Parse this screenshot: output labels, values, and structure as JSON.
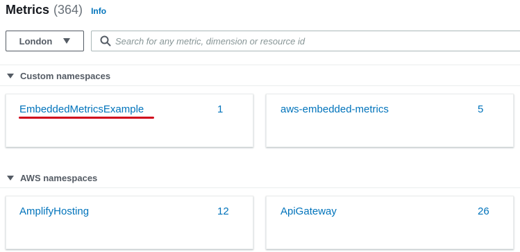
{
  "header": {
    "title": "Metrics",
    "count": "(364)",
    "info_label": "Info"
  },
  "toolbar": {
    "region_label": "London",
    "search_placeholder": "Search for any metric, dimension or resource id"
  },
  "sections": {
    "custom": {
      "label": "Custom namespaces",
      "cards": [
        {
          "name": "EmbeddedMetricsExample",
          "count": "1"
        },
        {
          "name": "aws-embedded-metrics",
          "count": "5"
        }
      ]
    },
    "aws": {
      "label": "AWS namespaces",
      "cards": [
        {
          "name": "AmplifyHosting",
          "count": "12"
        },
        {
          "name": "ApiGateway",
          "count": "26"
        }
      ]
    }
  },
  "colors": {
    "link": "#0073bb",
    "annotation_underline": "#d0021b"
  }
}
